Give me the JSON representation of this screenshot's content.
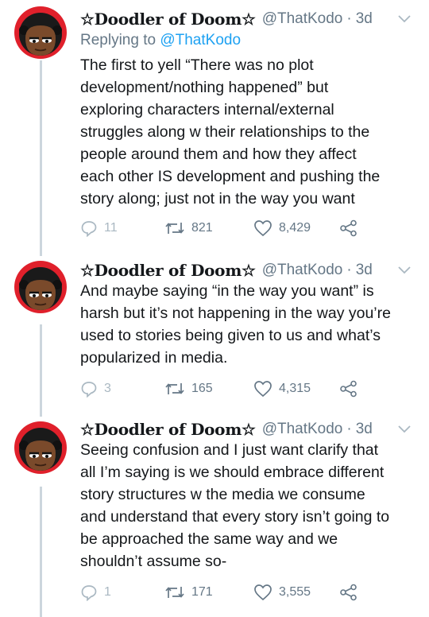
{
  "tweets": [
    {
      "display_name": "☆Doodler of Doom☆",
      "handle": "@ThatKodo",
      "separator": "·",
      "time": "3d",
      "replying_label": "Replying to",
      "replying_handle": "@ThatKodo",
      "lines": [
        "The first to yell “There was no plot",
        "development/nothing happened” but",
        "exploring characters internal/external",
        "struggles along w their relationships to the",
        "people around them and how they affect",
        "each other IS development and pushing the",
        "story along; just not in the way you want"
      ],
      "replies": "11",
      "retweets": "821",
      "likes": "8,429"
    },
    {
      "display_name": "☆Doodler of Doom☆",
      "handle": "@ThatKodo",
      "separator": "·",
      "time": "3d",
      "lines": [
        "And maybe saying “in the way you want” is",
        "harsh but it’s not happening in the way you’re",
        "used to stories being given to us and what’s",
        "popularized in media."
      ],
      "replies": "3",
      "retweets": "165",
      "likes": "4,315"
    },
    {
      "display_name": "☆Doodler of Doom☆",
      "handle": "@ThatKodo",
      "separator": "·",
      "time": "3d",
      "lines": [
        "Seeing confusion and I just want clarify that",
        "all I’m saying is we should embrace different",
        "story structures w the media we consume",
        "and understand that every story isn’t going to",
        "be approached the same way and we",
        "shouldn’t assume so-"
      ],
      "replies": "1",
      "retweets": "171",
      "likes": "3,555"
    }
  ],
  "colors": {
    "text": "#14171a",
    "secondary": "#657786",
    "link": "#1da1f2",
    "thread_line": "#ccd6dd",
    "avatar_ring": "#e0202b"
  }
}
